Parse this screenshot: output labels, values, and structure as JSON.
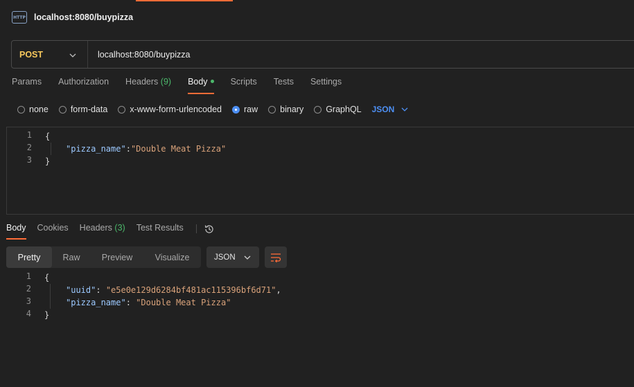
{
  "tab": {
    "title": "localhost:8080/buypizza",
    "icon": "http-icon"
  },
  "request": {
    "method": "POST",
    "url": "localhost:8080/buypizza",
    "tabs": [
      {
        "label": "Params"
      },
      {
        "label": "Authorization"
      },
      {
        "label": "Headers",
        "count": "(9)"
      },
      {
        "label": "Body",
        "active": true,
        "dot": true
      },
      {
        "label": "Scripts"
      },
      {
        "label": "Tests"
      },
      {
        "label": "Settings"
      }
    ],
    "body_types": [
      "none",
      "form-data",
      "x-www-form-urlencoded",
      "raw",
      "binary",
      "GraphQL"
    ],
    "selected_body_type": "raw",
    "language": "JSON",
    "body_lines": [
      {
        "n": "1",
        "text": "{"
      },
      {
        "n": "2",
        "key": "\"pizza_name\"",
        "sep": ":",
        "value": "\"Double Meat Pizza\""
      },
      {
        "n": "3",
        "text": "}"
      }
    ]
  },
  "response": {
    "tabs": [
      {
        "label": "Body",
        "active": true
      },
      {
        "label": "Cookies"
      },
      {
        "label": "Headers",
        "count": "(3)"
      },
      {
        "label": "Test Results"
      }
    ],
    "views": [
      "Pretty",
      "Raw",
      "Preview",
      "Visualize"
    ],
    "active_view": "Pretty",
    "format": "JSON",
    "body_lines": [
      {
        "n": "1",
        "text": "{"
      },
      {
        "n": "2",
        "key": "\"uuid\"",
        "sep": ": ",
        "value": "\"e5e0e129d6284bf481ac115396bf6d71\"",
        "tail": ","
      },
      {
        "n": "3",
        "key": "\"pizza_name\"",
        "sep": ": ",
        "value": "\"Double Meat Pizza\""
      },
      {
        "n": "4",
        "text": "}"
      }
    ]
  },
  "colors": {
    "accent": "#ff6c37",
    "method": "#f7c85c",
    "count": "#4cb86b",
    "link": "#4d8ff3"
  }
}
